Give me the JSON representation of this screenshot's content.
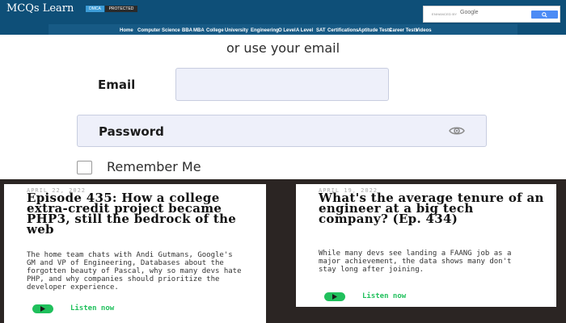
{
  "header": {
    "logo": "MCQs Learn",
    "badge_dmca": "DMCA",
    "badge_protected": "PROTECTED",
    "search": {
      "enhanced_by": "ENHANCED BY",
      "google": "Google"
    },
    "nav": [
      "Home",
      "Computer Science",
      "BBA",
      "MBA",
      "College",
      "University",
      "Engineering",
      "O Level",
      "A Level",
      "SAT",
      "Certifications",
      "Aptitude Tests",
      "Career Tests",
      "Videos"
    ]
  },
  "form": {
    "or_text": "or use your email",
    "email_label": "Email",
    "password_label": "Password",
    "remember_label": "Remember Me"
  },
  "cards": [
    {
      "date": "APRIL 22, 2022",
      "title": "Episode 435: How a college extra-credit project became PHP3, still the bedrock of the web",
      "description": "The home team chats with Andi Gutmans, Google's GM and VP of Engineering, Databases about the forgotten beauty of Pascal, why so many devs hate PHP, and why companies should prioritize the developer experience.",
      "listen": "Listen now"
    },
    {
      "date": "APRIL 19, 2022",
      "title": "What's the average tenure of an engineer at a big tech company? (Ep. 434)",
      "description": "While many devs see landing a FAANG job as a major achievement, the data shows many don't stay long after joining.",
      "listen": "Listen now"
    }
  ],
  "colors": {
    "header_bg": "#0e4f78",
    "band_bg": "#2b2523",
    "input_bg": "#eef0fa",
    "accent_green": "#20c05c",
    "search_button": "#4c8bf5"
  }
}
